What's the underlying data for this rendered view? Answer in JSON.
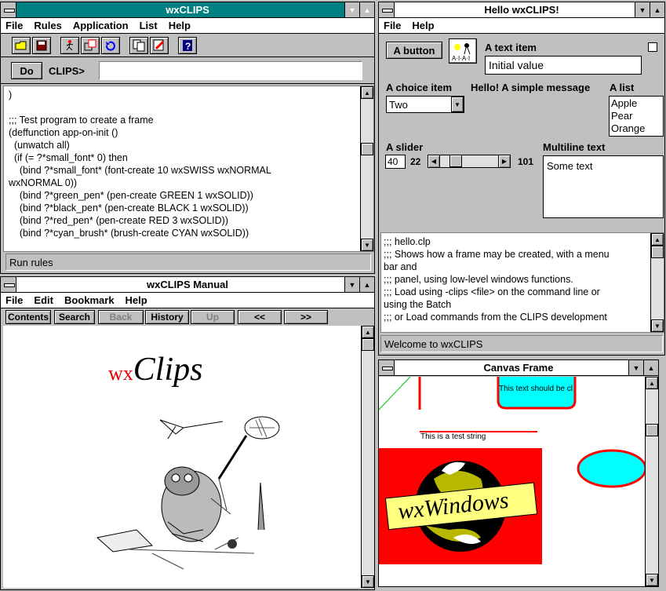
{
  "main_window": {
    "title": "wxCLIPS",
    "menu": [
      "File",
      "Rules",
      "Application",
      "List",
      "Help"
    ],
    "toolbar_icons": [
      "open-folder-icon",
      "save-icon",
      "run-icon",
      "step-icon",
      "undo-icon",
      "copy-icon",
      "clear-icon",
      "help-icon"
    ],
    "do_label": "Do",
    "prompt": "CLIPS>",
    "command_value": "",
    "code_lines": [
      ")",
      "",
      ";;; Test program to create a frame",
      "(deffunction app-on-init ()",
      "  (unwatch all)",
      "  (if (= ?*small_font* 0) then",
      "    (bind ?*small_font* (font-create 10 wxSWISS wxNORMAL",
      "wxNORMAL 0))",
      "    (bind ?*green_pen* (pen-create GREEN 1 wxSOLID))",
      "    (bind ?*black_pen* (pen-create BLACK 1 wxSOLID))",
      "    (bind ?*red_pen* (pen-create RED 3 wxSOLID))",
      "    (bind ?*cyan_brush* (brush-create CYAN wxSOLID))"
    ],
    "status": "Run rules"
  },
  "manual_window": {
    "title": "wxCLIPS Manual",
    "menu": [
      "File",
      "Edit",
      "Bookmark",
      "Help"
    ],
    "nav_buttons": [
      "Contents",
      "Search",
      "Back",
      "History",
      "Up",
      "<<",
      ">>"
    ],
    "logo_prefix": "wx",
    "logo_suffix": "Clips"
  },
  "hello_window": {
    "title": "Hello wxCLIPS!",
    "menu": [
      "File",
      "Help"
    ],
    "button_label": "A button",
    "text_item_label": "A text item",
    "text_item_value": "Initial value",
    "choice_label": "A choice item",
    "choice_value": "Two",
    "message": "Hello! A simple message",
    "list_label": "A list",
    "list_items": [
      "Apple",
      "Pear",
      "Orange"
    ],
    "slider_label": "A slider",
    "slider_value": "40",
    "slider_min": "22",
    "slider_max": "101",
    "slider_fraction": 0.22,
    "multiline_label": "Multiline text",
    "multiline_value": "Some text",
    "log_lines": [
      ";;; hello.clp",
      ";;; Shows how a frame may be created, with a menu",
      "bar and",
      ";;; panel, using low-level windows functions.",
      ";;; Load using -clips <file> on the command line or",
      "using the Batch",
      ";;; or Load commands from the CLIPS development"
    ],
    "status": "Welcome to wxCLIPS"
  },
  "canvas_window": {
    "title": "Canvas Frame",
    "clipped_text": "This text should be cl",
    "test_string": "This is a test string",
    "logo_text": "wxWindows"
  },
  "colors": {
    "title_active": "#008080",
    "red": "#ff0000",
    "cyan": "#00ffff",
    "canvas_red": "#ff0000"
  }
}
